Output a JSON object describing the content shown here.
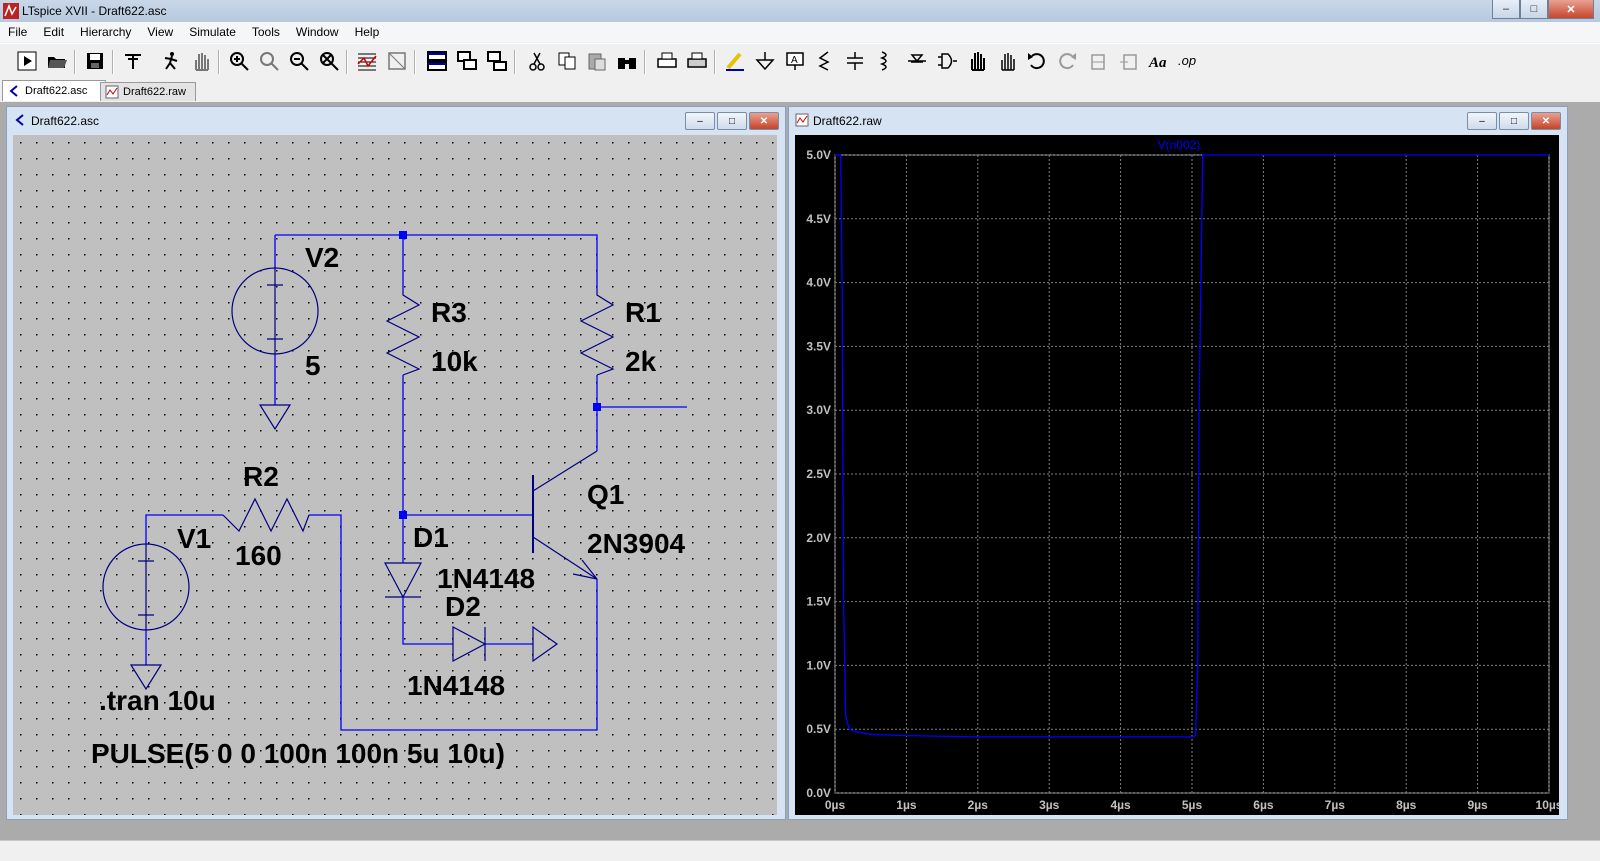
{
  "window": {
    "title": "LTspice XVII - Draft622.asc",
    "controls": {
      "minimize": "‒",
      "maximize": "□",
      "close": "✕"
    }
  },
  "menu": [
    "File",
    "Edit",
    "Hierarchy",
    "View",
    "Simulate",
    "Tools",
    "Window",
    "Help"
  ],
  "toolbar": {
    "icons": [
      "run-icon",
      "open-icon",
      "save-icon",
      "control-panel-icon",
      "halt-icon",
      "pan-icon",
      "zoom-in-icon",
      "zoom-to-fit-icon",
      "zoom-out-icon",
      "zoom-cancel-icon",
      "plot-icon",
      "plot-settings-icon",
      "tile-horizontal-icon",
      "cascade-icon",
      "tile-icon",
      "cut-icon",
      "copy-icon",
      "paste-icon",
      "find-icon",
      "print-icon",
      "print-preview-icon",
      "draw-wire-icon",
      "ground-icon",
      "label-net-icon",
      "resistor-icon",
      "capacitor-icon",
      "inductor-icon",
      "diode-icon",
      "component-icon",
      "move-icon",
      "drag-icon",
      "undo-icon",
      "redo-icon",
      "rotate-icon",
      "mirror-icon",
      "text-icon",
      "spice-directive-icon"
    ],
    "spice_directive_label": ".op",
    "text_label": "Aa"
  },
  "tabs": [
    {
      "label": "Draft622.asc",
      "icon": "schematic-icon"
    },
    {
      "label": "Draft622.raw",
      "icon": "waveform-icon"
    }
  ],
  "schematic": {
    "title": "Draft622.asc",
    "components": {
      "V2": {
        "name": "V2",
        "value": "5"
      },
      "R3": {
        "name": "R3",
        "value": "10k"
      },
      "R1": {
        "name": "R1",
        "value": "2k"
      },
      "R2": {
        "name": "R2",
        "value": "160"
      },
      "V1": {
        "name": "V1",
        "value": "PULSE(5 0 0 100n 100n 5u 10u)"
      },
      "Q1": {
        "name": "Q1",
        "value": "2N3904"
      },
      "D1": {
        "name": "D1",
        "value": "1N4148"
      },
      "D2": {
        "name": "D2",
        "value": "1N4148"
      }
    },
    "directive": ".tran 10u",
    "colors": {
      "wire": "#0000ff",
      "component": "#000080",
      "junction": "#0000ff",
      "background": "#c0c0c0"
    }
  },
  "waveform": {
    "title": "Draft622.raw",
    "trace_label": "V(n002)",
    "colors": {
      "trace": "#0000ff",
      "grid": "#808080",
      "background": "#000000",
      "axis_text": "#c0c0c0"
    }
  },
  "chart_data": {
    "type": "line",
    "title": "",
    "xlabel": "",
    "ylabel": "",
    "x_ticks": [
      "0µs",
      "1µs",
      "2µs",
      "3µs",
      "4µs",
      "5µs",
      "6µs",
      "7µs",
      "8µs",
      "9µs",
      "10µs"
    ],
    "y_ticks": [
      "0.0V",
      "0.5V",
      "1.0V",
      "1.5V",
      "2.0V",
      "2.5V",
      "3.0V",
      "3.5V",
      "4.0V",
      "4.5V",
      "5.0V"
    ],
    "xlim": [
      0,
      10
    ],
    "ylim": [
      0,
      5
    ],
    "grid": true,
    "legend": "top-center",
    "series": [
      {
        "name": "V(n002)",
        "x": [
          0,
          0.08,
          0.1,
          0.12,
          0.15,
          0.2,
          0.3,
          0.5,
          1.0,
          2.0,
          3.0,
          4.0,
          4.9,
          5.0,
          5.05,
          5.08,
          5.1,
          5.15,
          5.2,
          10
        ],
        "y": [
          5.0,
          5.0,
          4.0,
          1.5,
          0.6,
          0.5,
          0.48,
          0.46,
          0.45,
          0.44,
          0.44,
          0.44,
          0.44,
          0.44,
          0.45,
          1.0,
          3.0,
          5.0,
          5.0,
          5.0
        ]
      }
    ]
  }
}
